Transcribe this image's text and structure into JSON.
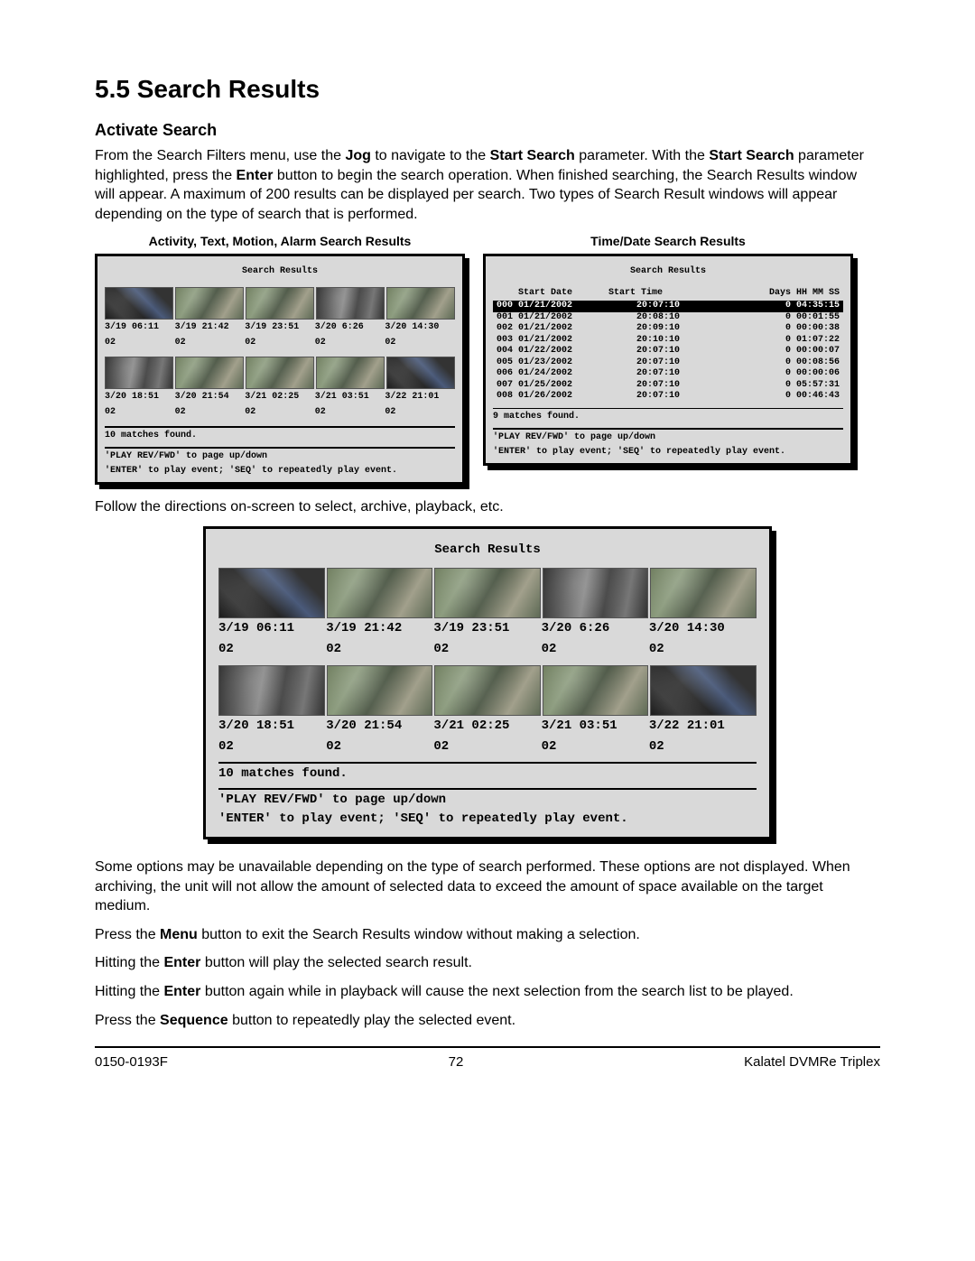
{
  "section": {
    "number": "5.5",
    "title": "Search Results"
  },
  "subheading": "Activate Search",
  "intro_parts": {
    "p1a": "From the Search Filters menu, use the ",
    "jog": "Jog",
    "p1b": " to navigate to the ",
    "start_search": "Start Search",
    "p1c": " parameter.  With the ",
    "start_search2": "Start Search",
    "p1d": " parameter highlighted, press the ",
    "enter": "Enter",
    "p1e": " button to begin the search operation. When finished searching, the Search Results window will appear. A maximum of 200 results can be displayed per search. Two types of Search Result windows will appear depending on the type of search that is performed."
  },
  "captions": {
    "left": "Activity, Text, Motion, Alarm Search Results",
    "right": "Time/Date Search Results"
  },
  "sr_panel": {
    "title": "Search Results",
    "row1_ts": [
      "3/19 06:11",
      "3/19 21:42",
      "3/19 23:51",
      "3/20 6:26",
      "3/20 14:30"
    ],
    "row1_ch": [
      "02",
      "02",
      "02",
      "02",
      "02"
    ],
    "row2_ts": [
      "3/20 18:51",
      "3/20 21:54",
      "3/21 02:25",
      "3/21 03:51",
      "3/22 21:01"
    ],
    "row2_ch": [
      "02",
      "02",
      "02",
      "02",
      "02"
    ],
    "matches": "10   matches found.",
    "help1": "'PLAY REV/FWD' to page up/down",
    "help2": "'ENTER' to play event; 'SEQ' to repeatedly play event."
  },
  "td_panel": {
    "title": "Search Results",
    "headers": {
      "date": "Start Date",
      "time": "Start Time",
      "dur": "Days HH MM SS"
    },
    "rows": [
      {
        "idx": "000",
        "date": "01/21/2002",
        "time": "20:07:10",
        "dur": "0 04:35:15",
        "selected": true
      },
      {
        "idx": "001",
        "date": "01/21/2002",
        "time": "20:08:10",
        "dur": "0 00:01:55",
        "selected": false
      },
      {
        "idx": "002",
        "date": "01/21/2002",
        "time": "20:09:10",
        "dur": "0 00:00:38",
        "selected": false
      },
      {
        "idx": "003",
        "date": "01/21/2002",
        "time": "20:10:10",
        "dur": "0 01:07:22",
        "selected": false
      },
      {
        "idx": "004",
        "date": "01/22/2002",
        "time": "20:07:10",
        "dur": "0 00:00:07",
        "selected": false
      },
      {
        "idx": "005",
        "date": "01/23/2002",
        "time": "20:07:10",
        "dur": "0 00:08:56",
        "selected": false
      },
      {
        "idx": "006",
        "date": "01/24/2002",
        "time": "20:07:10",
        "dur": "0 00:00:06",
        "selected": false
      },
      {
        "idx": "007",
        "date": "01/25/2002",
        "time": "20:07:10",
        "dur": "0 05:57:31",
        "selected": false
      },
      {
        "idx": "008",
        "date": "01/26/2002",
        "time": "20:07:10",
        "dur": "0 00:46:43",
        "selected": false
      }
    ],
    "matches": "9    matches found.",
    "help1": "'PLAY REV/FWD' to page up/down",
    "help2": "'ENTER' to play event; 'SEQ' to repeatedly play event."
  },
  "follow_text": "Follow the directions on-screen to select, archive, playback, etc.",
  "para_options": "Some options may be unavailable depending on the type of search performed. These options are not displayed. When archiving, the unit will not allow the amount of selected data to exceed the amount of space available on the target medium.",
  "para_menu": {
    "a": "Press the ",
    "b": "Menu",
    "c": " button to exit the Search Results window without making a selection."
  },
  "para_enter": {
    "a": "Hitting the ",
    "b": "Enter",
    "c": " button will play the selected search result."
  },
  "para_enter2": {
    "a": "Hitting the ",
    "b": "Enter",
    "c": " button again while in playback will cause the next selection from the search list to be played."
  },
  "para_seq": {
    "a": "Press the ",
    "b": "Sequence",
    "c": " button to repeatedly play the selected event."
  },
  "footer": {
    "left": "0150-0193F",
    "center": "72",
    "right": "Kalatel DVMRe Triplex"
  }
}
